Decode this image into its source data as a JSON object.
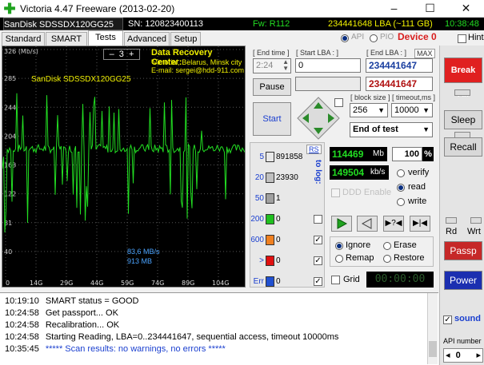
{
  "window": {
    "title": "Victoria 4.47  Freeware (2013-02-20)",
    "minimize": "–",
    "maximize": "☐",
    "close": "✕"
  },
  "infobar": {
    "model": "SanDisk SDSSDX120GG25",
    "serial": "SN: 120823400113",
    "firmware": "Fw: R112",
    "lba": "234441648 LBA (~111 GB)",
    "time": "10:38:48"
  },
  "tabs": [
    "Standard",
    "SMART",
    "Tests",
    "Advanced",
    "Setup"
  ],
  "api_options": [
    "API",
    "PIO"
  ],
  "device_label": "Device 0",
  "hints_label": "Hints",
  "graph": {
    "unit": "326 (Mb/s)",
    "y_ticks": [
      "326",
      "285",
      "244",
      "204",
      "163",
      "122",
      "81",
      "40"
    ],
    "x_ticks": [
      "0",
      "14G",
      "29G",
      "44G",
      "59G",
      "74G",
      "89G",
      "104G"
    ],
    "counter": "3",
    "center_title": "Data Recovery Center:",
    "center_line2": "'Victoria', Belarus, Minsk city",
    "center_email": "E-mail: sergei@hdd-911.com",
    "model_label": "SanDisk SDSSDX120GG25",
    "speed_label": "83,6 MB/s",
    "size_label": "913 MB"
  },
  "controls": {
    "end_time_label": "[ End time ]",
    "end_time_value": "2:24",
    "start_lba_label": "[ Start LBA : ]",
    "start_lba_value": "0",
    "end_lba_label": "[ End LBA : ]",
    "max_label": "MAX",
    "end_lba_value": "234441647",
    "end_lba_current": "234441647",
    "pause_label": "Pause",
    "start_label": "Start",
    "block_size_label": "[ block size ]",
    "block_size_value": "256",
    "timeout_label": "[ timeout,ms ]",
    "timeout_value": "10000",
    "end_of_test": "End of test"
  },
  "blocks": {
    "rs_label": "RS",
    "to_log_label": "to log:",
    "rows": [
      {
        "label": "5",
        "count": "891858",
        "color": "#e8e8e8"
      },
      {
        "label": "20",
        "count": "23930",
        "color": "#c0c0c0"
      },
      {
        "label": "50",
        "count": "1",
        "color": "#a0a0a0"
      },
      {
        "label": "200",
        "count": "0",
        "color": "#20c020"
      },
      {
        "label": "600",
        "count": "0",
        "color": "#f08020"
      },
      {
        "label": ">",
        "count": "0",
        "color": "#e01010"
      },
      {
        "label": "Err",
        "count": "0",
        "color": "#2050d0"
      }
    ]
  },
  "stats": {
    "mb": "114469",
    "mb_unit": "Mb",
    "percent": "100",
    "percent_unit": "%",
    "kbs": "149504",
    "kbs_unit": "kb/s",
    "ddd_enable": "DDD Enable",
    "verify": "verify",
    "read": "read",
    "write": "write"
  },
  "actions": {
    "ignore": "Ignore",
    "erase": "Erase",
    "remap": "Remap",
    "restore": "Restore",
    "grid": "Grid",
    "timer": "00:00:00"
  },
  "side": {
    "break_all": "Break All",
    "sleep": "Sleep",
    "recall": "Recall",
    "rd": "Rd",
    "wrt": "Wrt",
    "passp": "Passp",
    "power": "Power",
    "sound": "sound",
    "api_number_label": "API number",
    "api_number": "0"
  },
  "log": [
    {
      "time": "10:19:10",
      "text": "SMART status = GOOD",
      "color": "#000000"
    },
    {
      "time": "10:24:58",
      "text": "Get passport... OK",
      "color": "#000000"
    },
    {
      "time": "10:24:58",
      "text": "Recalibration... OK",
      "color": "#000000"
    },
    {
      "time": "10:24:58",
      "text": "Starting Reading, LBA=0..234441647, sequential access, timeout 10000ms",
      "color": "#000000"
    },
    {
      "time": "10:35:45",
      "text": "***** Scan results: no warnings, no errors *****",
      "color": "#1a3fcf"
    }
  ],
  "colors": {
    "graph_line": "#22dd22",
    "accent_red": "#d81e1e",
    "info_green": "#22dd22",
    "info_yellow": "#f0f000"
  }
}
